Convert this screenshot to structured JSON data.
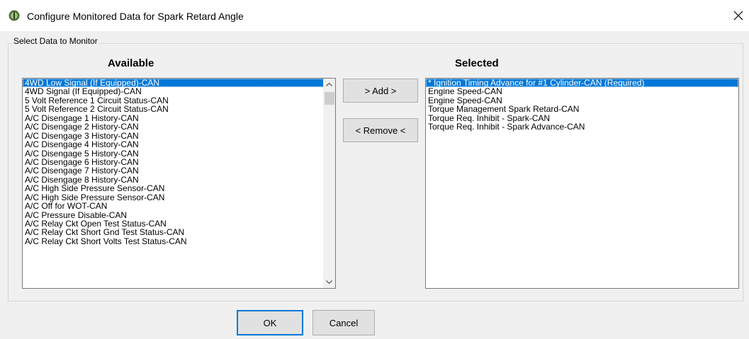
{
  "window": {
    "title": "Configure Monitored Data for Spark Retard Angle",
    "icon": "app-icon",
    "close_icon": "close-icon"
  },
  "group": {
    "label": "Select Data to Monitor"
  },
  "available": {
    "heading": "Available",
    "items": [
      "4WD Low Signal (If Equipped)-CAN",
      "4WD Signal (If Equipped)-CAN",
      "5 Volt Reference 1 Circuit Status-CAN",
      "5 Volt Reference 2 Circuit Status-CAN",
      "A/C Disengage 1 History-CAN",
      "A/C Disengage 2 History-CAN",
      "A/C Disengage 3 History-CAN",
      "A/C Disengage 4 History-CAN",
      "A/C Disengage 5 History-CAN",
      "A/C Disengage 6 History-CAN",
      "A/C Disengage 7 History-CAN",
      "A/C Disengage 8 History-CAN",
      "A/C High Side Pressure Sensor-CAN",
      "A/C High Side Pressure Sensor-CAN",
      "A/C Off for WOT-CAN",
      "A/C Pressure Disable-CAN",
      "A/C Relay Ckt Open Test Status-CAN",
      "A/C Relay Ckt Short Gnd Test Status-CAN",
      "A/C Relay Ckt Short Volts Test Status-CAN"
    ],
    "selected_index": 0
  },
  "selected": {
    "heading": "Selected",
    "items": [
      "* Ignition Timing Advance for #1 Cylinder-CAN (Required)",
      "Engine Speed-CAN",
      "Engine Speed-CAN",
      "Torque Management Spark Retard-CAN",
      "Torque Req. Inhibit - Spark-CAN",
      "Torque Req. Inhibit - Spark Advance-CAN"
    ],
    "selected_index": 0
  },
  "buttons": {
    "add": "> Add >",
    "remove": "< Remove <",
    "ok": "OK",
    "cancel": "Cancel"
  },
  "colors": {
    "selection": "#0078d7",
    "window_bg": "#f0f0f0",
    "button_bg": "#e1e1e1"
  }
}
